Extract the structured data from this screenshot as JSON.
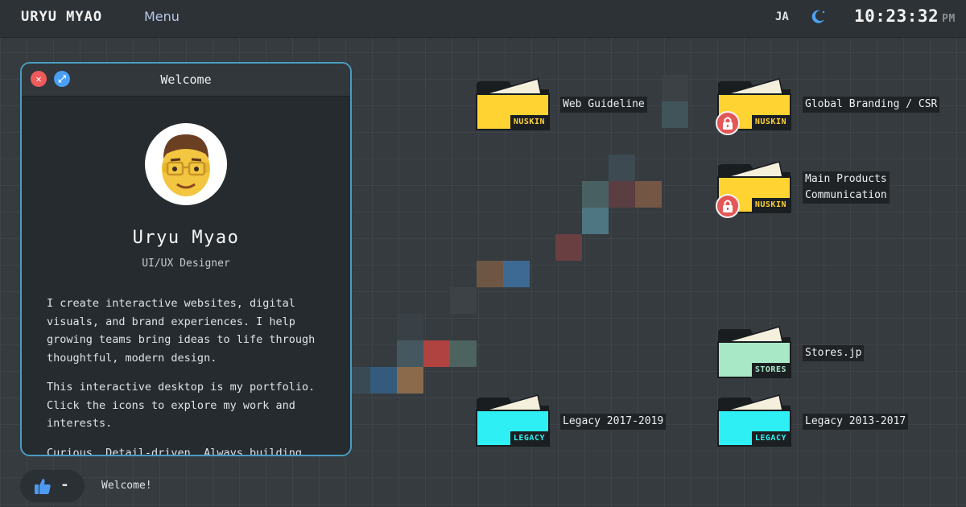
{
  "topbar": {
    "logo": "URYU MYAO",
    "menu_label": "Menu",
    "language": "JA",
    "theme_icon": "moon-icon",
    "time": "10:23:32",
    "ampm": "PM"
  },
  "window": {
    "title": "Welcome",
    "close_icon": "close-icon",
    "maximize_icon": "expand-icon",
    "profile": {
      "name": "Uryu Myao",
      "role": "UI/UX Designer"
    },
    "bio": [
      "I create interactive websites, digital visuals, and brand experiences. I help growing teams bring ideas to life through thoughtful, modern design.",
      "This interactive desktop is my portfolio. Click the icons to explore my work and interests.",
      "Curious. Detail-driven. Always building."
    ]
  },
  "status": {
    "like_icon": "thumbs-up-icon",
    "like_count": "-",
    "message": "Welcome!"
  },
  "folders": [
    {
      "label": "Web Guideline",
      "tag": "NUSKIN",
      "color": "#ffd332",
      "locked": false
    },
    {
      "label": "Global Branding / CSR",
      "tag": "NUSKIN",
      "color": "#ffd332",
      "locked": true
    },
    {
      "label": "Main Products\nCommunication",
      "tag": "NUSKIN",
      "color": "#ffd332",
      "locked": true
    },
    {
      "label": "Stores.jp",
      "tag": "STORES",
      "color": "#a8e8c6",
      "locked": false
    },
    {
      "label": "Legacy 2017-2019",
      "tag": "LEGACY",
      "color": "#2ef0f4",
      "locked": false
    },
    {
      "label": "Legacy 2013-2017",
      "tag": "LEGACY",
      "color": "#2ef0f4",
      "locked": false
    }
  ],
  "colors": {
    "window_border": "#4a9cc0",
    "folder_nuskin": "#ffd332",
    "folder_stores": "#a8e8c6",
    "folder_legacy": "#2ef0f4",
    "lock_badge": "#e45757"
  }
}
